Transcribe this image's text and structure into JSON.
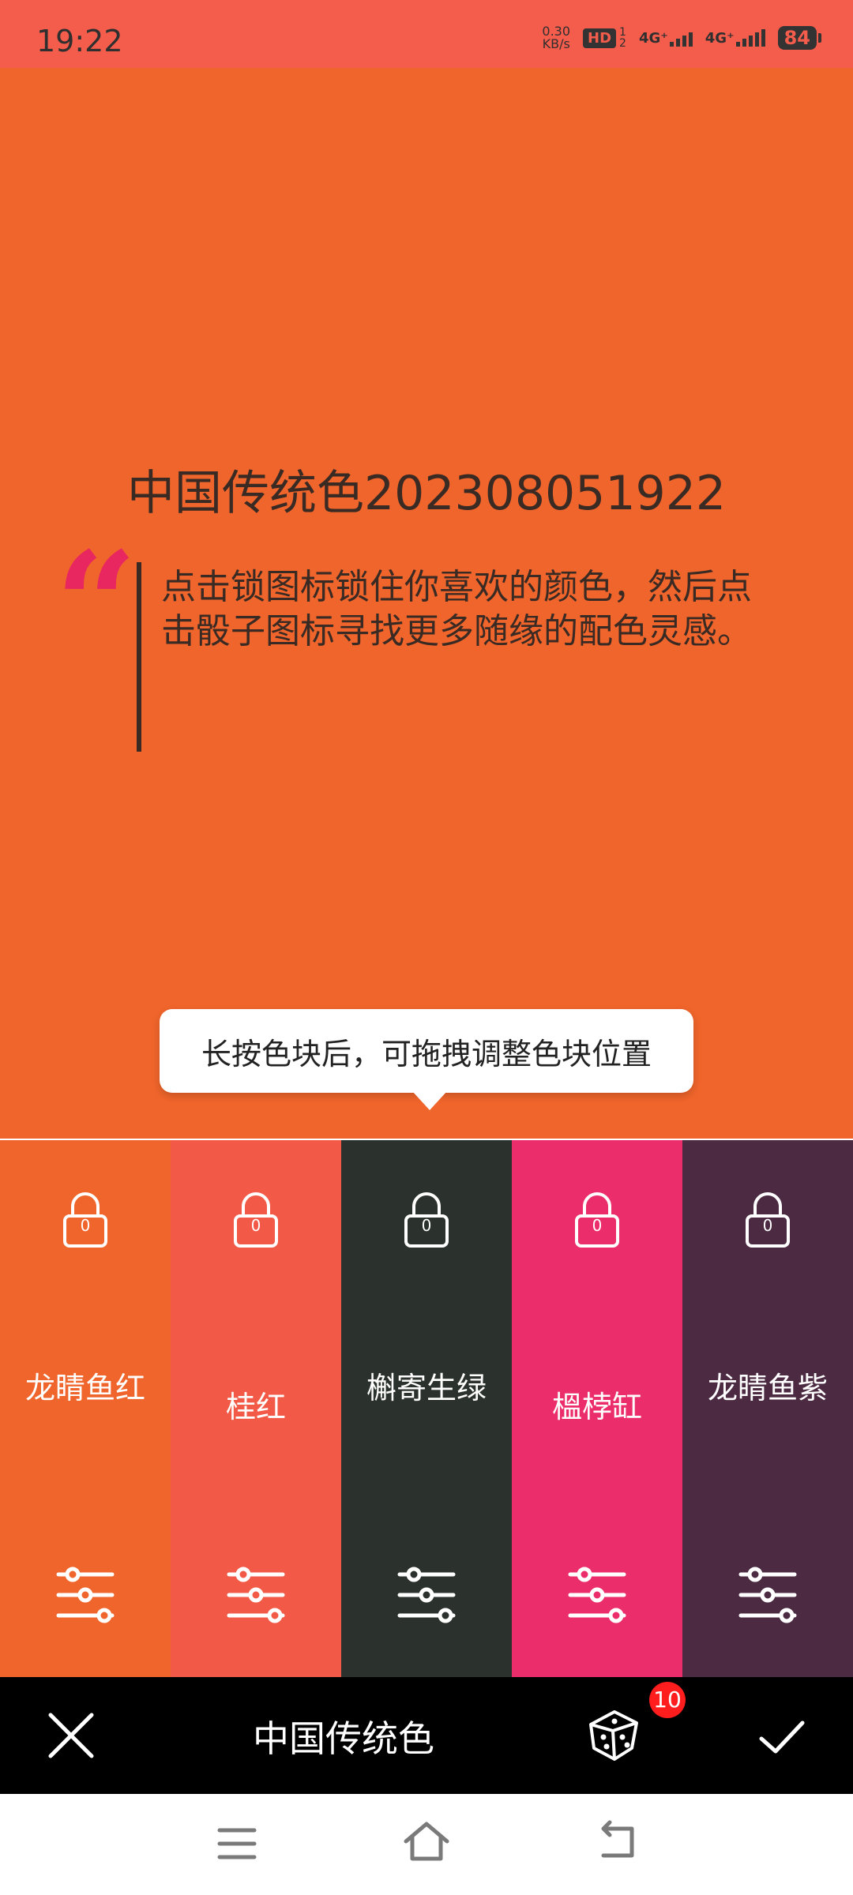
{
  "status_bar": {
    "time": "19:22",
    "net_speed_value": "0.30",
    "net_speed_unit": "KB/s",
    "hd_label": "HD",
    "sim1_sub": "1",
    "sim2_sub": "2",
    "signal1": "4G⁺",
    "signal2": "4G⁺",
    "battery": "84"
  },
  "main": {
    "title": "中国传统色202308051922",
    "quote_glyph": "“",
    "quote_text": "点击锁图标锁住你喜欢的颜色，然后点击骰子图标寻找更多随缘的配色灵感。",
    "tooltip": "长按色块后，可拖拽调整色块位置",
    "background_color": "#f0652b"
  },
  "swatches": [
    {
      "name": "龙睛鱼红",
      "color": "#f0652b",
      "lock_count": "0",
      "icon_lock": "lock-icon",
      "icon_adjust": "sliders-icon"
    },
    {
      "name": "桂红",
      "color": "#f25a47",
      "lock_count": "0",
      "icon_lock": "lock-icon",
      "icon_adjust": "sliders-icon"
    },
    {
      "name": "槲寄生绿",
      "color": "#2b312c",
      "lock_count": "0",
      "icon_lock": "lock-icon",
      "icon_adjust": "sliders-icon"
    },
    {
      "name": "榲桲缸",
      "color": "#ec2d6b",
      "lock_count": "0",
      "icon_lock": "lock-icon",
      "icon_adjust": "sliders-icon"
    },
    {
      "name": "龙睛鱼紫",
      "color": "#4b2a42",
      "lock_count": "0",
      "icon_lock": "lock-icon",
      "icon_adjust": "sliders-icon"
    }
  ],
  "action_bar": {
    "title": "中国传统色",
    "dice_badge": "10",
    "icons": [
      "close-icon",
      "dice-icon",
      "check-icon"
    ]
  },
  "nav_bar": {
    "icons": [
      "menu-icon",
      "home-icon",
      "back-icon"
    ]
  }
}
